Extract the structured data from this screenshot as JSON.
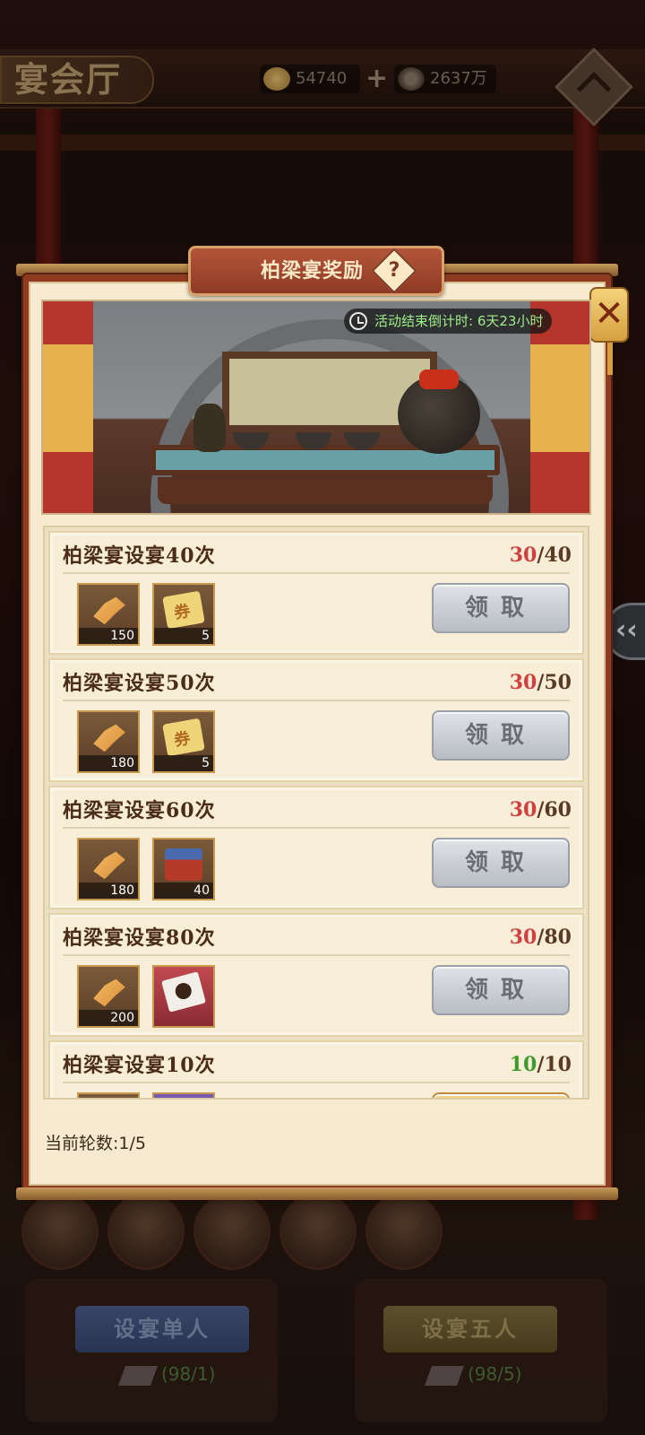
{
  "header": {
    "hall_title": "宴会厅",
    "gold_amount": "54740",
    "coin_amount": "2637万"
  },
  "modal": {
    "title": "柏梁宴奖励",
    "countdown": "活动结束倒计时: 6天23小时",
    "round_label": "当前轮数:",
    "round_value": "1/5",
    "tasks": [
      {
        "name": "柏梁宴设宴40次",
        "current": "30",
        "target": "/40",
        "rewards": [
          {
            "icon": "token-icon",
            "qty": "150"
          },
          {
            "icon": "coupon-icon",
            "qty": "5"
          }
        ],
        "button": "领取",
        "status": "locked"
      },
      {
        "name": "柏梁宴设宴50次",
        "current": "30",
        "target": "/50",
        "rewards": [
          {
            "icon": "token-icon",
            "qty": "180"
          },
          {
            "icon": "coupon-icon",
            "qty": "5"
          }
        ],
        "button": "领取",
        "status": "locked"
      },
      {
        "name": "柏梁宴设宴60次",
        "current": "30",
        "target": "/60",
        "rewards": [
          {
            "icon": "token-icon",
            "qty": "180"
          },
          {
            "icon": "treasure-chest-icon",
            "qty": "40"
          }
        ],
        "button": "领取",
        "status": "locked"
      },
      {
        "name": "柏梁宴设宴80次",
        "current": "30",
        "target": "/80",
        "rewards": [
          {
            "icon": "token-icon",
            "qty": "200"
          },
          {
            "icon": "letter-icon",
            "qty": ""
          }
        ],
        "button": "领取",
        "status": "locked"
      },
      {
        "name": "柏梁宴设宴10次",
        "current": "10",
        "target": "/10",
        "rewards": [
          {
            "icon": "token-icon",
            "qty": ""
          },
          {
            "icon": "purple-item-icon",
            "qty": ""
          }
        ],
        "button": "",
        "status": "claimable"
      }
    ]
  },
  "footer": {
    "single_button": "设宴单人",
    "five_button": "设宴五人",
    "single_count": "(98/1)",
    "five_count": "(98/5)"
  },
  "colors": {
    "progress_incomplete": "#d04040",
    "progress_complete": "#3e9a2c",
    "countdown_text": "#9ef08a"
  }
}
